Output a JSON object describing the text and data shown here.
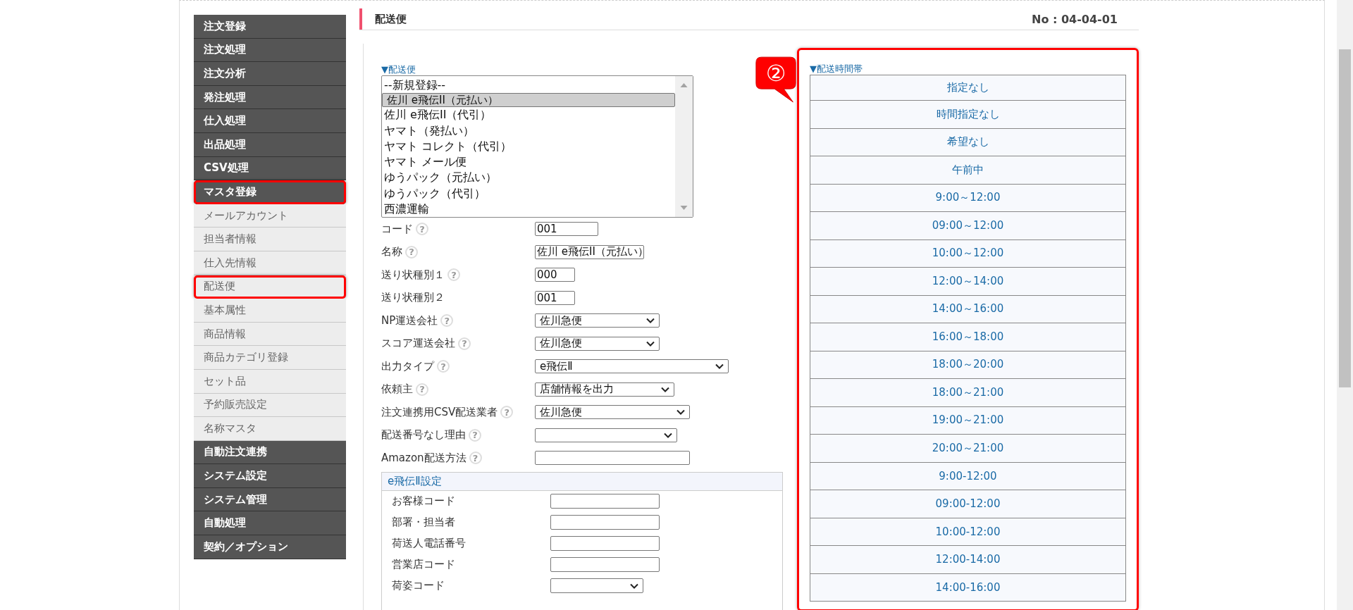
{
  "sidebar": {
    "items": [
      {
        "label": "注文登録",
        "annotated": false
      },
      {
        "label": "注文処理",
        "annotated": false
      },
      {
        "label": "注文分析",
        "annotated": false
      },
      {
        "label": "発注処理",
        "annotated": false
      },
      {
        "label": "仕入処理",
        "annotated": false
      },
      {
        "label": "出品処理",
        "annotated": false
      },
      {
        "label": "CSV処理",
        "annotated": false
      },
      {
        "label": "マスタ登録",
        "annotated": true,
        "children": [
          {
            "label": "メールアカウント",
            "annotated": false
          },
          {
            "label": "担当者情報",
            "annotated": false
          },
          {
            "label": "仕入先情報",
            "annotated": false
          },
          {
            "label": "配送便",
            "annotated": true
          },
          {
            "label": "基本属性",
            "annotated": false
          },
          {
            "label": "商品情報",
            "annotated": false
          },
          {
            "label": "商品カテゴリ登録",
            "annotated": false
          },
          {
            "label": "セット品",
            "annotated": false
          },
          {
            "label": "予約販売設定",
            "annotated": false
          },
          {
            "label": "名称マスタ",
            "annotated": false
          }
        ]
      },
      {
        "label": "自動注文連携",
        "annotated": false
      },
      {
        "label": "システム設定",
        "annotated": false
      },
      {
        "label": "システム管理",
        "annotated": false
      },
      {
        "label": "自動処理",
        "annotated": false
      },
      {
        "label": "契約／オプション",
        "annotated": false
      }
    ]
  },
  "header": {
    "title": "配送便",
    "page_no": "No : 04-04-01"
  },
  "carrier_list": {
    "label": "▼配送便",
    "options": [
      {
        "text": "--新規登録--",
        "selected": false
      },
      {
        "text": "佐川 e飛伝II（元払い）",
        "selected": true
      },
      {
        "text": "佐川 e飛伝II（代引）",
        "selected": false
      },
      {
        "text": "ヤマト（発払い）",
        "selected": false
      },
      {
        "text": "ヤマト コレクト（代引）",
        "selected": false
      },
      {
        "text": "ヤマト メール便",
        "selected": false
      },
      {
        "text": "ゆうパック（元払い）",
        "selected": false
      },
      {
        "text": "ゆうパック（代引）",
        "selected": false
      },
      {
        "text": "西濃運輸",
        "selected": false
      }
    ]
  },
  "fields": [
    {
      "label": "コード",
      "help": "?",
      "kind": "text",
      "value": "001"
    },
    {
      "label": "名称",
      "help": "?",
      "kind": "text",
      "value": "佐川 e飛伝II（元払い）"
    },
    {
      "label": "送り状種別１",
      "help": "?",
      "kind": "text",
      "value": "000"
    },
    {
      "label": "送り状種別２",
      "kind": "text",
      "value": "001"
    },
    {
      "label": "NP運送会社",
      "help": "?",
      "kind": "select",
      "value": "佐川急便"
    },
    {
      "label": "スコア運送会社",
      "help": "?",
      "kind": "select",
      "value": "佐川急便"
    },
    {
      "label": "出力タイプ",
      "help": "?",
      "kind": "select",
      "value": "e飛伝Ⅱ"
    },
    {
      "label": "依頼主",
      "help": "?",
      "kind": "select",
      "value": "店舗情報を出力"
    },
    {
      "label": "注文連携用CSV配送業者",
      "help": "?",
      "kind": "select",
      "value": "佐川急便"
    },
    {
      "label": "配送番号なし理由",
      "help": "?",
      "kind": "select"
    },
    {
      "label": "Amazon配送方法",
      "help": "?",
      "kind": "text"
    }
  ],
  "ehiden_settings": {
    "title": "e飛伝Ⅱ設定",
    "fields": [
      {
        "label": "お客様コード",
        "kind": "text"
      },
      {
        "label": "部署・担当者",
        "kind": "text"
      },
      {
        "label": "荷送人電話番号",
        "kind": "text"
      },
      {
        "label": "営業店コード",
        "kind": "text"
      },
      {
        "label": "荷姿コード",
        "kind": "select"
      }
    ]
  },
  "callout": {
    "text": "②"
  },
  "time_slots": {
    "label": "▼配送時間帯",
    "items": [
      "指定なし",
      "時間指定なし",
      "希望なし",
      "午前中",
      "9:00～12:00",
      "09:00～12:00",
      "10:00～12:00",
      "12:00～14:00",
      "14:00～16:00",
      "16:00～18:00",
      "18:00～20:00",
      "18:00～21:00",
      "19:00～21:00",
      "20:00～21:00",
      "9:00-12:00",
      "09:00-12:00",
      "10:00-12:00",
      "12:00-14:00",
      "14:00-16:00"
    ]
  }
}
